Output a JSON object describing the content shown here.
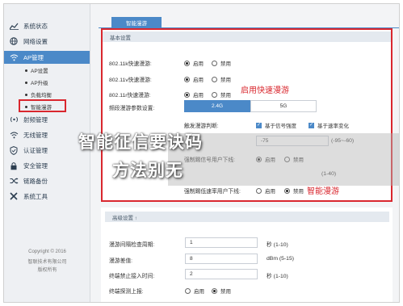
{
  "sidebar": {
    "items": [
      {
        "label": "系统状态",
        "icon": "chart-line-icon"
      },
      {
        "label": "网络设置",
        "icon": "globe-icon"
      },
      {
        "label": "AP管理",
        "icon": "wifi-icon"
      },
      {
        "label": "射频管理",
        "icon": "radio-icon"
      },
      {
        "label": "无线管理",
        "icon": "wireless-icon"
      },
      {
        "label": "认证管理",
        "icon": "shield-check-icon"
      },
      {
        "label": "安全管理",
        "icon": "lock-icon"
      },
      {
        "label": "链路备份",
        "icon": "shuffle-icon"
      },
      {
        "label": "系统工具",
        "icon": "tools-icon"
      }
    ],
    "subitems": [
      {
        "label": "AP设置"
      },
      {
        "label": "AP升级"
      },
      {
        "label": "负载均衡"
      },
      {
        "label": "智能漫游"
      }
    ],
    "footer": [
      "Copyright © 2016",
      "智联技术有限公司",
      "版权所有"
    ]
  },
  "tab": {
    "label": "智能漫游"
  },
  "basic": {
    "title": "基本设置",
    "rows": [
      {
        "label": "802.11k快速漫游:"
      },
      {
        "label": "802.11v快速漫游:"
      },
      {
        "label": "802.11r快速漫游:"
      }
    ],
    "enable": "启用",
    "disable": "禁用",
    "band_label": "频段漫游参数设置:",
    "band_24": "2.4G",
    "band_5": "5G",
    "trigger_label": "触发漫游判断:",
    "trigger_signal": "基于信号强度",
    "trigger_rate": "基于速率变化",
    "signal_value": "-75",
    "signal_range": "(-95~-60)",
    "kick_label": "强制踢信号用户下线:",
    "kick_range": "(1-40)",
    "lowrate_label": "强制踢低速率用户下线:"
  },
  "annotations": {
    "fast_roam": "启用快速漫游",
    "smart_roam": "智能漫游"
  },
  "overlay": {
    "line1": "智能征信要诀码",
    "line2": "方法别无"
  },
  "advanced": {
    "title": "高级设置 ↑",
    "rows": [
      {
        "label": "漫游间隔检查周期:",
        "value": "1",
        "unit": "秒 (1-10)"
      },
      {
        "label": "漫游差值:",
        "value": "8",
        "unit": "dBm (5-15)"
      },
      {
        "label": "终端禁止接入时间:",
        "value": "2",
        "unit": "秒 (1-10)"
      },
      {
        "label": "终端探测上报:",
        "enable": "启用",
        "disable": "禁用"
      }
    ]
  },
  "colors": {
    "accent": "#4b89c8",
    "highlight": "#d9272e"
  }
}
